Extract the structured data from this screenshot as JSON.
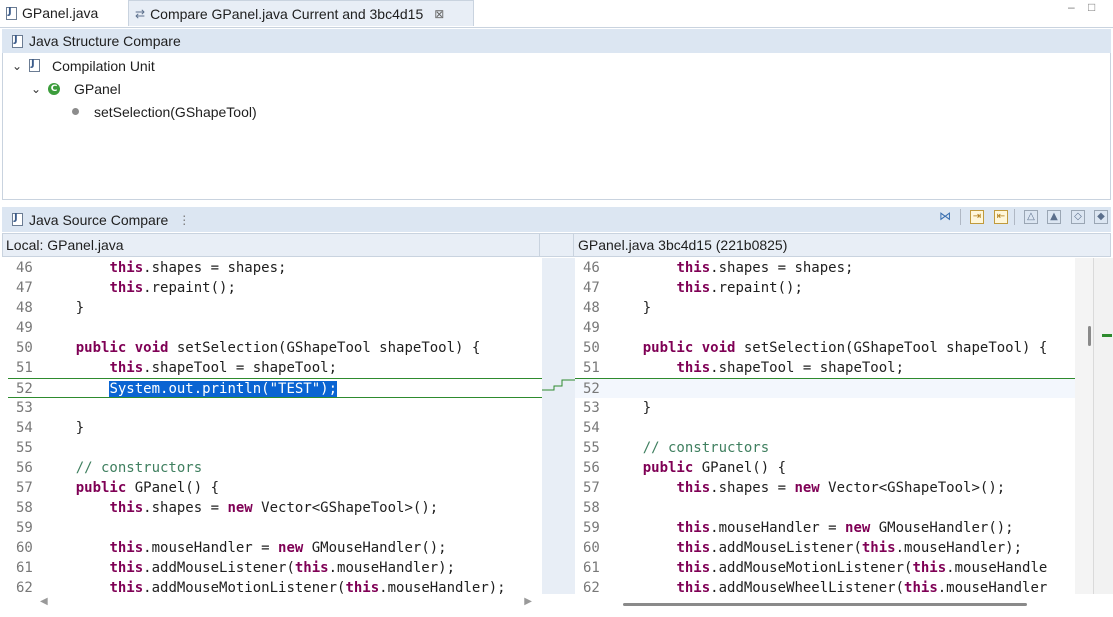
{
  "tabs": [
    {
      "label": "GPanel.java",
      "icon": "java-file-icon",
      "active": false
    },
    {
      "label": "Compare GPanel.java Current and 3bc4d15",
      "icon": "compare-icon",
      "active": true,
      "close": "⊠"
    }
  ],
  "window_controls": {
    "minimize": "–",
    "maximize": "□"
  },
  "structure_compare": {
    "title": "Java Structure Compare",
    "tree": {
      "root": "Compilation Unit",
      "class": "GPanel",
      "class_badge": "C",
      "method": "setSelection(GShapeTool)"
    }
  },
  "source_compare": {
    "title": "Java Source Compare",
    "left_header": "Local: GPanel.java",
    "right_header": "GPanel.java 3bc4d15 (221b0825)",
    "toolbar_icons": [
      "ignore-whitespace-icon",
      "copy-left-to-right-icon",
      "copy-right-to-left-icon",
      "next-difference-icon",
      "previous-difference-icon",
      "next-change-icon",
      "previous-change-icon"
    ],
    "left_lines": [
      {
        "num": "46",
        "text": "        this.shapes = shapes;"
      },
      {
        "num": "47",
        "text": "        this.repaint();"
      },
      {
        "num": "48",
        "text": "    }"
      },
      {
        "num": "49",
        "text": ""
      },
      {
        "num": "50",
        "text": "    public void setSelection(GShapeTool shapeTool) {"
      },
      {
        "num": "51",
        "text": "        this.shapeTool = shapeTool;"
      },
      {
        "num": "52",
        "text": "        System.out.println(\"TEST\");",
        "selected": true
      },
      {
        "num": "53",
        "text": ""
      },
      {
        "num": "54",
        "text": "    }"
      },
      {
        "num": "55",
        "text": ""
      },
      {
        "num": "56",
        "text": "    // constructors"
      },
      {
        "num": "57",
        "text": "    public GPanel() {"
      },
      {
        "num": "58",
        "text": "        this.shapes = new Vector<GShapeTool>();"
      },
      {
        "num": "59",
        "text": ""
      },
      {
        "num": "60",
        "text": "        this.mouseHandler = new GMouseHandler();"
      },
      {
        "num": "61",
        "text": "        this.addMouseListener(this.mouseHandler);"
      },
      {
        "num": "62",
        "text": "        this.addMouseMotionListener(this.mouseHandler);"
      }
    ],
    "right_lines": [
      {
        "num": "46",
        "text": "        this.shapes = shapes;"
      },
      {
        "num": "47",
        "text": "        this.repaint();"
      },
      {
        "num": "48",
        "text": "    }"
      },
      {
        "num": "49",
        "text": ""
      },
      {
        "num": "50",
        "text": "    public void setSelection(GShapeTool shapeTool) {"
      },
      {
        "num": "51",
        "text": "        this.shapeTool = shapeTool;"
      },
      {
        "num": "52",
        "text": "",
        "changed": true
      },
      {
        "num": "53",
        "text": "    }"
      },
      {
        "num": "54",
        "text": ""
      },
      {
        "num": "55",
        "text": "    // constructors"
      },
      {
        "num": "56",
        "text": "    public GPanel() {"
      },
      {
        "num": "57",
        "text": "        this.shapes = new Vector<GShapeTool>();"
      },
      {
        "num": "58",
        "text": ""
      },
      {
        "num": "59",
        "text": "        this.mouseHandler = new GMouseHandler();"
      },
      {
        "num": "60",
        "text": "        this.addMouseListener(this.mouseHandler);"
      },
      {
        "num": "61",
        "text": "        this.addMouseMotionListener(this.mouseHandle"
      },
      {
        "num": "62",
        "text": "        this.addMouseWheelListener(this.mouseHandler"
      }
    ]
  },
  "colors": {
    "selection": "#0a64d2",
    "keyword": "#7f0055",
    "comment": "#3f7f5f",
    "diff_line": "#2e8b2e",
    "panel_header": "#dce6f2"
  }
}
